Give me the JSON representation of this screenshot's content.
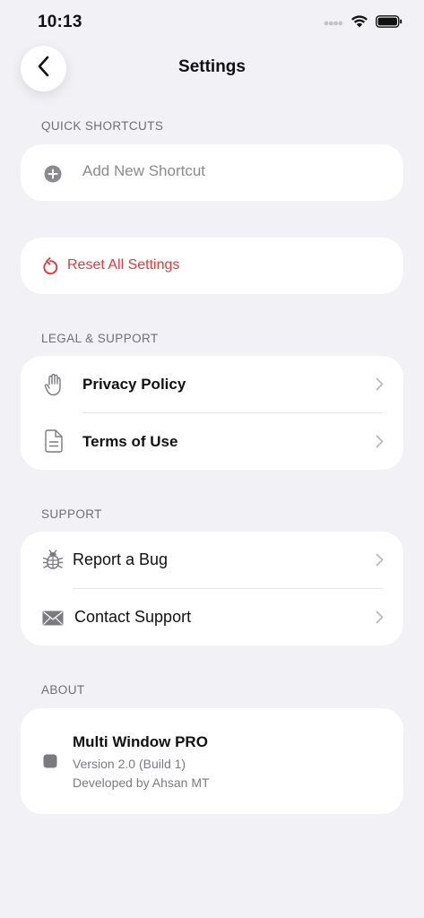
{
  "status_bar": {
    "time": "10:13"
  },
  "nav": {
    "title": "Settings"
  },
  "quick_shortcuts": {
    "header": "QUICK SHORTCUTS",
    "add_label": "Add New Shortcut"
  },
  "reset": {
    "label": "Reset All Settings"
  },
  "legal": {
    "header": "LEGAL & SUPPORT",
    "privacy_label": "Privacy Policy",
    "terms_label": "Terms of Use"
  },
  "support": {
    "header": "SUPPORT",
    "bug_label": "Report a Bug",
    "contact_label": "Contact Support"
  },
  "about": {
    "header": "ABOUT",
    "app_name": "Multi Window PRO",
    "version": "Version 2.0 (Build 1)",
    "developer": "Developed by Ahsan MT"
  },
  "colors": {
    "background": "#f1f1f6",
    "danger": "#e5383b",
    "secondary_text": "#6e6e73",
    "chevron": "#b8b8bd"
  }
}
